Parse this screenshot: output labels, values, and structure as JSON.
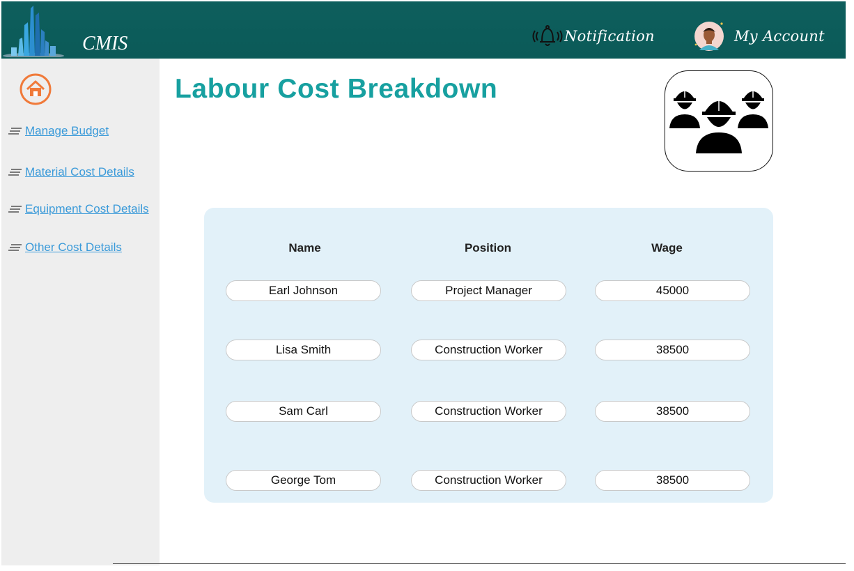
{
  "header": {
    "brand": "CMIS",
    "notification_label": "Notification",
    "account_label": "My Account"
  },
  "sidebar": {
    "home_icon": "home-icon",
    "items": [
      {
        "label": "Manage Budget"
      },
      {
        "label": "Material Cost Details"
      },
      {
        "label": "Equipment Cost Details"
      },
      {
        "label": "Other Cost Details"
      }
    ]
  },
  "main": {
    "title": "Labour Cost Breakdown",
    "table": {
      "columns": [
        "Name",
        "Position",
        "Wage"
      ],
      "rows": [
        {
          "name": "Earl Johnson",
          "position": "Project Manager",
          "wage": "45000"
        },
        {
          "name": "Lisa Smith",
          "position": "Construction Worker",
          "wage": "38500"
        },
        {
          "name": "Sam Carl",
          "position": "Construction Worker",
          "wage": "38500"
        },
        {
          "name": "George Tom",
          "position": "Construction Worker",
          "wage": "38500"
        }
      ]
    }
  },
  "colors": {
    "header_bg": "#0b5a58",
    "title": "#17a0a0",
    "link": "#3a9ad9",
    "home_icon": "#f07a3a",
    "panel_bg": "#e2f1f9"
  }
}
